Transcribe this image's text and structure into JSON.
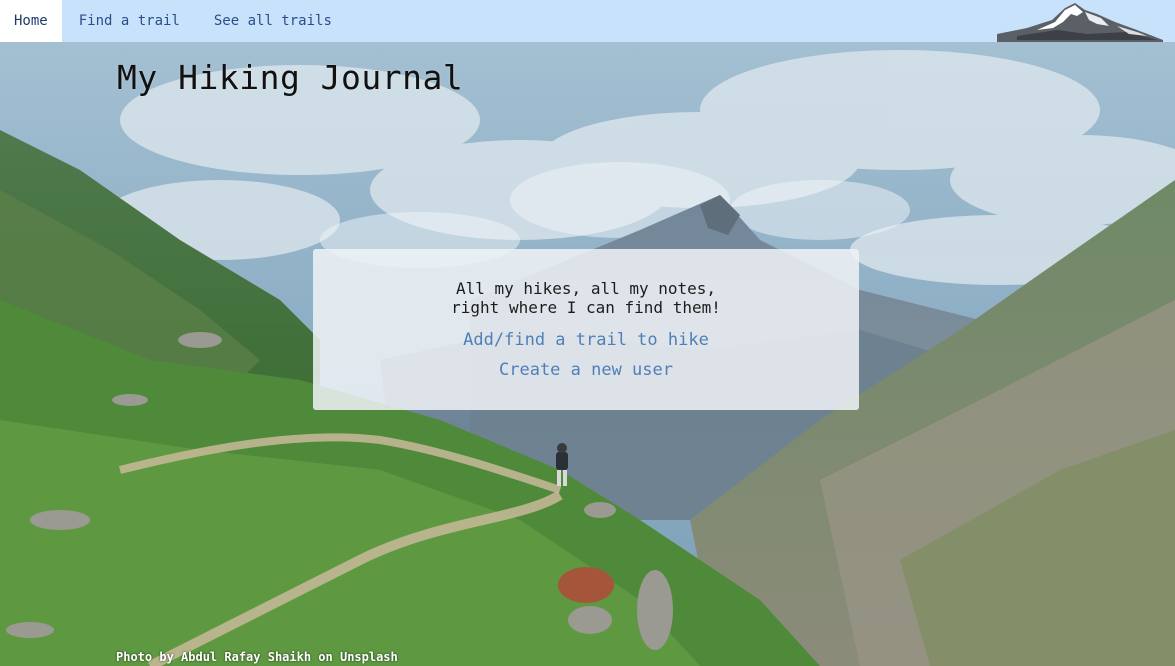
{
  "nav": {
    "items": [
      {
        "label": "Home",
        "active": true
      },
      {
        "label": "Find a trail",
        "active": false
      },
      {
        "label": "See all trails",
        "active": false
      }
    ],
    "logo_icon": "snowy-mountain-icon"
  },
  "header": {
    "title": "My Hiking Journal"
  },
  "hero": {
    "tagline_line1": "All my hikes, all my notes,",
    "tagline_line2": "right where I can find them!",
    "link_find_trail": "Add/find a trail to hike",
    "link_new_user": "Create a new user"
  },
  "footer": {
    "photo_credit": "Photo by Abdul Rafay Shaikh on Unsplash"
  },
  "colors": {
    "navbar_bg": "#c9e2fb",
    "nav_text": "#2b4d8a",
    "link": "#4f7fb8"
  }
}
